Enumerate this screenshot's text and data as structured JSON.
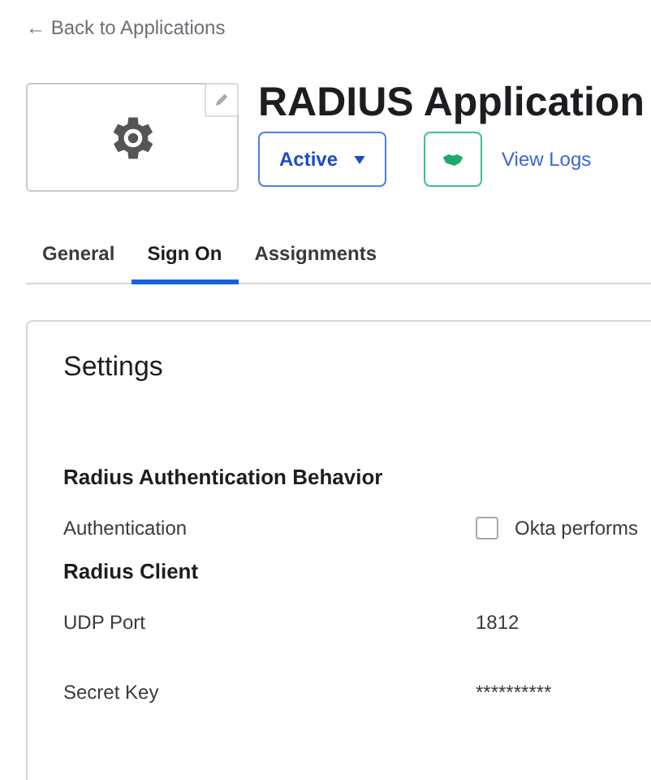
{
  "back_link": "← Back to Applications",
  "app": {
    "title": "RADIUS Application",
    "status": "Active"
  },
  "view_logs": "View Logs",
  "tabs": [
    {
      "label": "General",
      "selected": false
    },
    {
      "label": "Sign On",
      "selected": true
    },
    {
      "label": "Assignments",
      "selected": false
    }
  ],
  "settings": {
    "title": "Settings",
    "sections": [
      {
        "heading": "Radius Authentication Behavior",
        "rows": [
          {
            "kind": "checkbox",
            "label": "Authentication",
            "value": "Okta performs",
            "checked": false
          }
        ]
      },
      {
        "heading": "Radius Client",
        "rows": [
          {
            "kind": "text",
            "label": "UDP Port",
            "value": "1812"
          },
          {
            "kind": "text",
            "label": "Secret Key",
            "value": "**********"
          }
        ]
      }
    ]
  }
}
